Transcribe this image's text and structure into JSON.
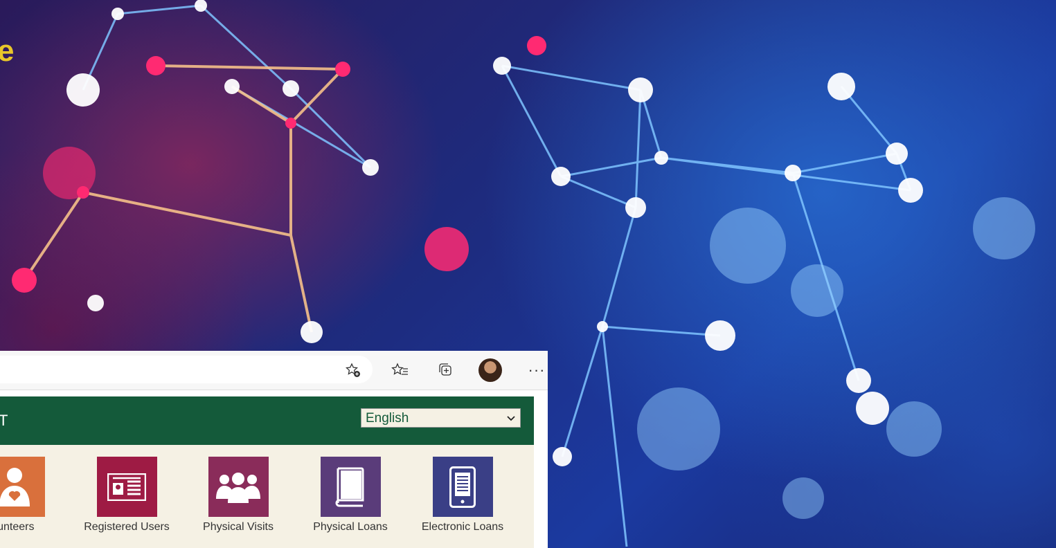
{
  "background": {
    "letter": "e"
  },
  "browser": {
    "toolbar": {
      "icons": [
        "add-favorite-icon",
        "favorites-icon",
        "collections-icon",
        "profile-avatar",
        "more-icon"
      ],
      "more_label": "···"
    },
    "page": {
      "header_title_fragment": "T",
      "language": {
        "selected": "English"
      },
      "stats": [
        {
          "label": "lunteers",
          "icon": "volunteer-icon",
          "color": "#d9703c"
        },
        {
          "label": "Registered Users",
          "icon": "id-card-icon",
          "color": "#9e1b44"
        },
        {
          "label": "Physical Visits",
          "icon": "group-icon",
          "color": "#8a2c5a"
        },
        {
          "label": "Physical Loans",
          "icon": "book-icon",
          "color": "#5a3c7a"
        },
        {
          "label": "Electronic Loans",
          "icon": "tablet-icon",
          "color": "#3a3f86"
        }
      ]
    }
  }
}
